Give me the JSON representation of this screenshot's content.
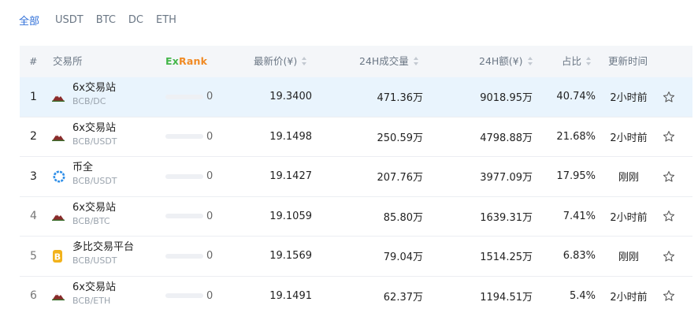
{
  "filter_tabs": [
    {
      "label": "全部",
      "active": true
    },
    {
      "label": "USDT",
      "active": false
    },
    {
      "label": "BTC",
      "active": false
    },
    {
      "label": "DC",
      "active": false
    },
    {
      "label": "ETH",
      "active": false
    }
  ],
  "colors": {
    "accent": "#2f6fd8",
    "highlight_row": "#e9f4fd",
    "header_bg": "#f4f6f9",
    "exrank_green": "#44b64a",
    "exrank_orange": "#f08a24",
    "exrank_red": "#e84a5f"
  },
  "table": {
    "headers": {
      "index": "#",
      "exchange": "交易所",
      "exrank_prefix": "Ex",
      "exrank_suffix": "Rank",
      "price": "最新价(¥)",
      "volume_24h": "24H成交量",
      "amount_24h": "24H额(¥)",
      "share": "占比",
      "updated": "更新时间"
    },
    "rows": [
      {
        "rank": "1",
        "exchange": "6x交易站",
        "pair": "BCB/DC",
        "logo": "mountain-logo-icon",
        "score": "0",
        "score_fraction": 0,
        "price": "19.3400",
        "volume": "471.36万",
        "amount": "9018.95万",
        "share": "40.74%",
        "updated": "2小时前"
      },
      {
        "rank": "2",
        "exchange": "6x交易站",
        "pair": "BCB/USDT",
        "logo": "mountain-logo-icon",
        "score": "0",
        "score_fraction": 0,
        "price": "19.1498",
        "volume": "250.59万",
        "amount": "4798.88万",
        "share": "21.68%",
        "updated": "2小时前"
      },
      {
        "rank": "3",
        "exchange": "币全",
        "pair": "BCB/USDT",
        "logo": "ring-logo-icon",
        "score": "0",
        "score_fraction": 0,
        "price": "19.1427",
        "volume": "207.76万",
        "amount": "3977.09万",
        "share": "17.95%",
        "updated": "刚刚"
      },
      {
        "rank": "4",
        "exchange": "6x交易站",
        "pair": "BCB/BTC",
        "logo": "mountain-logo-icon",
        "score": "0",
        "score_fraction": 0,
        "price": "19.1059",
        "volume": "85.80万",
        "amount": "1639.31万",
        "share": "7.41%",
        "updated": "2小时前"
      },
      {
        "rank": "5",
        "exchange": "多比交易平台",
        "pair": "BCB/USDT",
        "logo": "bitcoin-logo-icon",
        "score": "0",
        "score_fraction": 0,
        "price": "19.1569",
        "volume": "79.04万",
        "amount": "1514.25万",
        "share": "6.83%",
        "updated": "刚刚"
      },
      {
        "rank": "6",
        "exchange": "6x交易站",
        "pair": "BCB/ETH",
        "logo": "mountain-logo-icon",
        "score": "0",
        "score_fraction": 0,
        "price": "19.1491",
        "volume": "62.37万",
        "amount": "1194.51万",
        "share": "5.4%",
        "updated": "2小时前"
      }
    ]
  }
}
